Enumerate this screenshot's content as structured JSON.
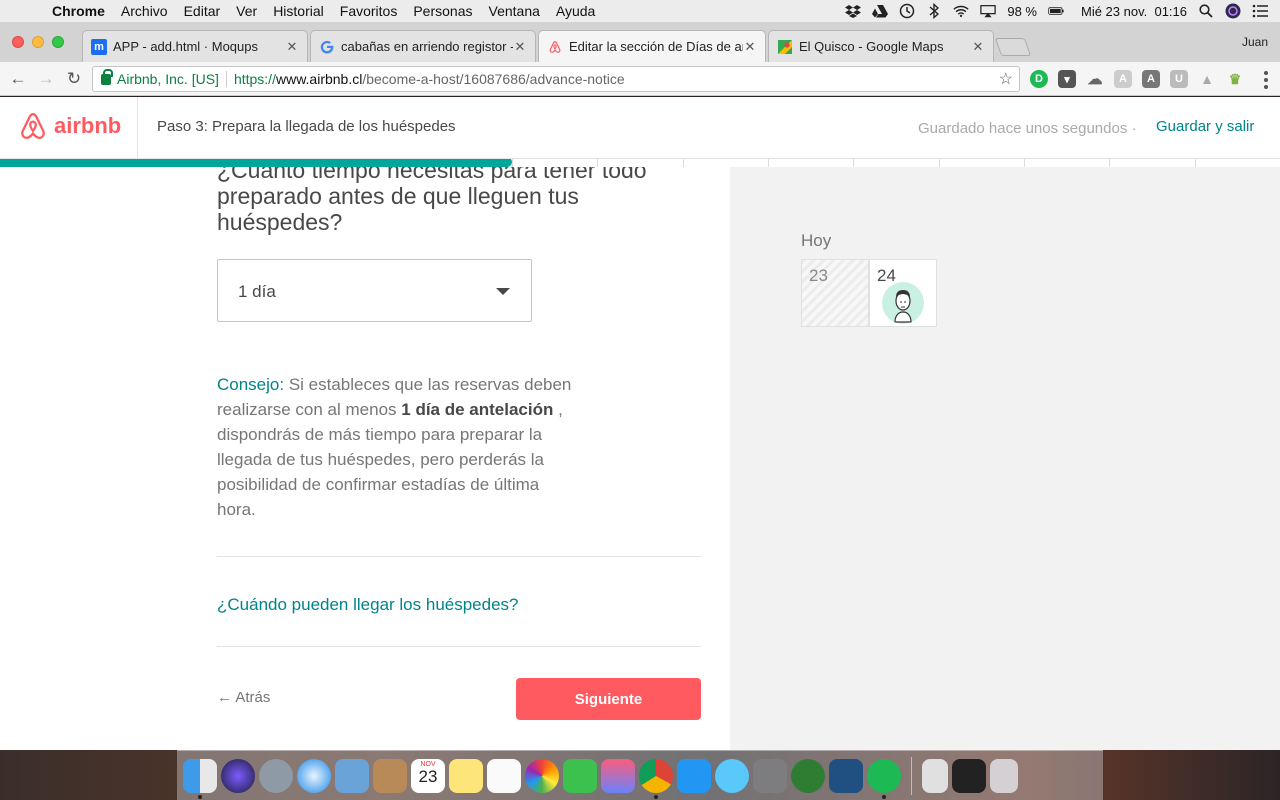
{
  "menubar": {
    "app": "Chrome",
    "items": [
      "Archivo",
      "Editar",
      "Ver",
      "Historial",
      "Favoritos",
      "Personas",
      "Ventana",
      "Ayuda"
    ],
    "battery": "98 %",
    "datetime": "Mié 23 nov.  01:16"
  },
  "tabs": [
    {
      "label": "APP - add.html · Moqups",
      "favicon": "moqups-icon",
      "active": false
    },
    {
      "label": "cabañas en arriendo registor -",
      "favicon": "google-icon",
      "active": false
    },
    {
      "label": "Editar la sección de Días de an",
      "favicon": "airbnb-icon",
      "active": true
    },
    {
      "label": "El Quisco - Google Maps",
      "favicon": "maps-icon",
      "active": false
    }
  ],
  "profile_name": "Juan",
  "address": {
    "secure_label": "Airbnb, Inc. [US]",
    "scheme": "https://",
    "host": "www.airbnb.cl",
    "path": "/become-a-host/16087686/advance-notice"
  },
  "header": {
    "logo_text": "airbnb",
    "step": "Paso 3: Prepara la llegada de los huéspedes",
    "saved_status": "Guardado hace unos segundos ·",
    "save_exit": "Guardar y salir",
    "progress": 0.4
  },
  "main": {
    "question": "¿Cuánto tiempo necesitas para tener todo preparado antes de que lleguen tus huéspedes?",
    "notice_select": "1 día",
    "tip_label": "Consejo:",
    "tip_text_1": " Si estableces que las reservas deben realizarse con al menos ",
    "tip_bold": "1 día de antelación",
    "tip_text_2": " , dispondrás de más tiempo para preparar la llegada de tus huéspedes, pero perderás la posibilidad de confirmar estadías de última hora.",
    "arrival_link": "¿Cuándo pueden llegar los huéspedes?",
    "back_label": "Atrás",
    "next_label": "Siguiente"
  },
  "calendar": {
    "today_label": "Hoy",
    "days": [
      "23",
      "24"
    ]
  },
  "colors": {
    "brand": "#ff5a5f",
    "teal": "#008489",
    "progress": "#00a699"
  },
  "dock_icons": [
    "finder-icon",
    "siri-icon",
    "launchpad-icon",
    "safari-icon",
    "mail-icon",
    "contacts-icon",
    "calendar-icon",
    "notes-icon",
    "reminders-icon",
    "photos-icon",
    "facetime-icon",
    "itunes-icon",
    "chrome-icon",
    "app-store-icon",
    "messages-icon",
    "system-preferences-icon",
    "qgis-icon",
    "sourcetree-icon",
    "spotify-icon",
    "downloads-icon",
    "terminal-icon",
    "trash-icon"
  ],
  "dock_calendar": {
    "month": "NOV",
    "day": "23"
  }
}
